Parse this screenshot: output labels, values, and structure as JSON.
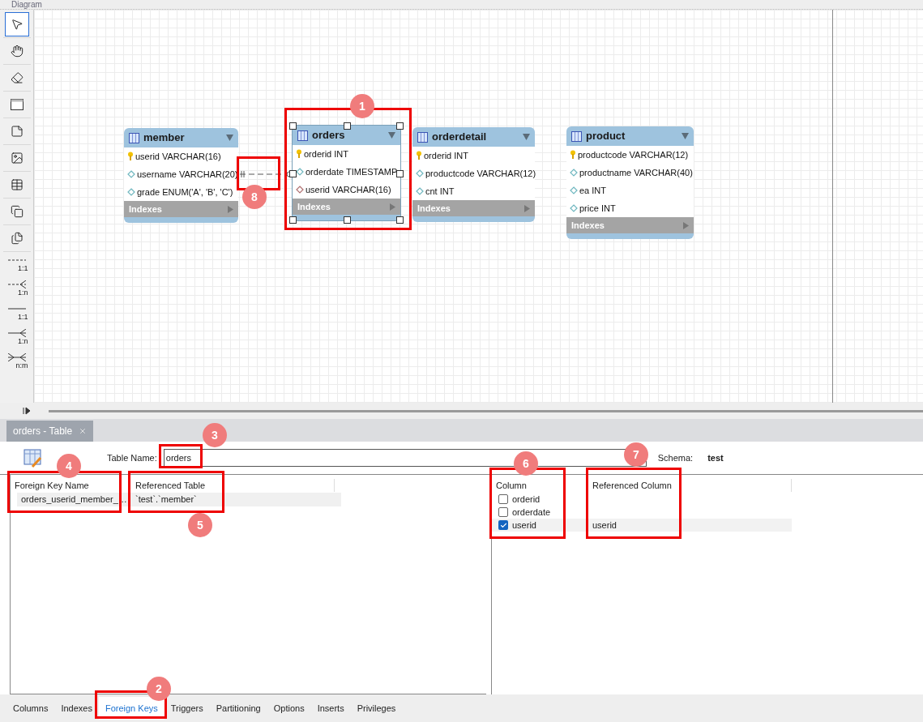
{
  "diagram": {
    "title": "Diagram",
    "tools": [
      {
        "kind": "tool",
        "selected": true
      },
      {
        "kind": "tool",
        "selected": false
      },
      {
        "kind": "tool",
        "selected": false
      },
      {
        "kind": "tool",
        "selected": false
      },
      {
        "kind": "tool",
        "selected": false
      },
      {
        "kind": "tool",
        "selected": false
      },
      {
        "kind": "tool",
        "selected": false
      },
      {
        "kind": "tool",
        "selected": false
      },
      {
        "kind": "tool",
        "selected": false
      },
      {
        "kind": "relation",
        "label": "1:1",
        "identifying": false,
        "selected": false
      },
      {
        "kind": "relation",
        "label": "1:n",
        "identifying": false,
        "selected": false
      },
      {
        "kind": "relation",
        "label": "1:1",
        "identifying": true,
        "selected": false
      },
      {
        "kind": "relation",
        "label": "1:n",
        "identifying": true,
        "selected": false
      },
      {
        "kind": "relation",
        "label": "n:m",
        "identifying": true,
        "selected": false
      }
    ],
    "tables": [
      {
        "name": "member",
        "selected": false,
        "indexes_label": "Indexes",
        "columns": [
          {
            "kind": "primary",
            "text": "userid VARCHAR(16)"
          },
          {
            "kind": "column",
            "text": "username VARCHAR(20)"
          },
          {
            "kind": "column",
            "text": "grade ENUM('A', 'B', 'C')"
          }
        ]
      },
      {
        "name": "orders",
        "selected": true,
        "indexes_label": "Indexes",
        "columns": [
          {
            "kind": "primary",
            "text": "orderid INT"
          },
          {
            "kind": "column",
            "text": "orderdate TIMESTAMP"
          },
          {
            "kind": "foreign",
            "text": "userid VARCHAR(16)"
          }
        ]
      },
      {
        "name": "orderdetail",
        "selected": false,
        "indexes_label": "Indexes",
        "columns": [
          {
            "kind": "primary",
            "text": "orderid INT"
          },
          {
            "kind": "column",
            "text": "productcode VARCHAR(12)"
          },
          {
            "kind": "column",
            "text": "cnt INT"
          }
        ]
      },
      {
        "name": "product",
        "selected": false,
        "indexes_label": "Indexes",
        "columns": [
          {
            "kind": "primary",
            "text": "productcode VARCHAR(12)"
          },
          {
            "kind": "column",
            "text": "productname VARCHAR(40)"
          },
          {
            "kind": "column",
            "text": "ea INT"
          },
          {
            "kind": "column",
            "text": "price INT"
          }
        ]
      }
    ]
  },
  "editor": {
    "tab": {
      "label": "orders - Table",
      "selected": true
    },
    "table_name_label": "Table Name:",
    "table_name": "orders",
    "schema_label": "Schema:",
    "schema": "test",
    "foreign_keys": {
      "columns": [
        "Foreign Key Name",
        "Referenced Table"
      ],
      "rows": [
        {
          "name": "orders_userid_member_…",
          "referenced_table": "`test`.`member`",
          "selected": true
        }
      ]
    },
    "key_columns": {
      "columns": [
        "Column",
        "Referenced Column"
      ],
      "rows": [
        {
          "column": "orderid",
          "checked": false,
          "selected": false
        },
        {
          "column": "orderdate",
          "checked": false,
          "selected": false
        },
        {
          "column": "userid",
          "checked": true,
          "referenced_column": "userid",
          "selected": true
        }
      ]
    },
    "tabs": [
      {
        "label": "Columns",
        "selected": false
      },
      {
        "label": "Indexes",
        "selected": false
      },
      {
        "label": "Foreign Keys",
        "selected": true
      },
      {
        "label": "Triggers",
        "selected": false
      },
      {
        "label": "Partitioning",
        "selected": false
      },
      {
        "label": "Options",
        "selected": false
      },
      {
        "label": "Inserts",
        "selected": false
      },
      {
        "label": "Privileges",
        "selected": false
      }
    ]
  },
  "annotations": [
    {
      "number": "1"
    },
    {
      "number": "2"
    },
    {
      "number": "3"
    },
    {
      "number": "4"
    },
    {
      "number": "5"
    },
    {
      "number": "6"
    },
    {
      "number": "7"
    },
    {
      "number": "8"
    }
  ]
}
